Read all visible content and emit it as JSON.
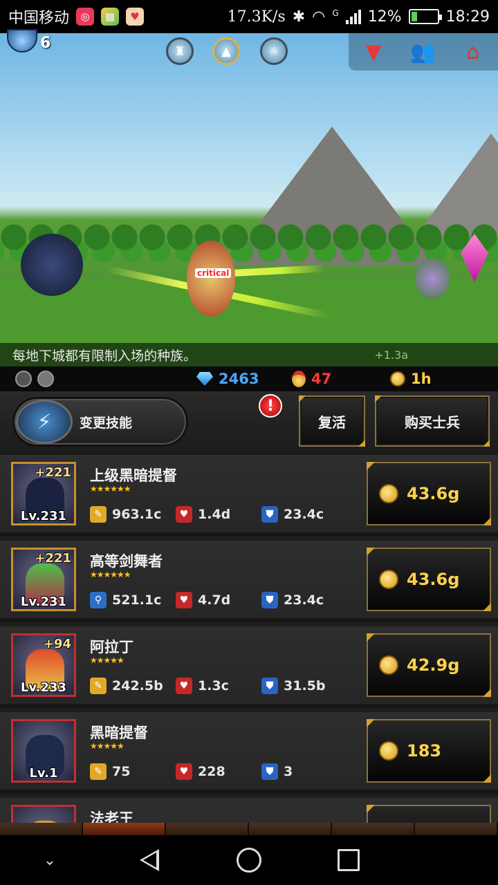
{
  "status_bar": {
    "carrier": "中国移动",
    "speed": "17.3K/s",
    "network": "G",
    "battery": "12%",
    "time": "18:29"
  },
  "game": {
    "player_level": "6",
    "effect_text": "critical",
    "tip": "每地下城都有限制入场的种族。",
    "rate": "+1.3a"
  },
  "resources": {
    "gems": "2463",
    "medals": "47",
    "time_boost": "1h"
  },
  "actions": {
    "change_skill": "变更技能",
    "revive": "复活",
    "buy_soldier": "购买士兵",
    "alert": "!"
  },
  "units": [
    {
      "name": "上级黑暗提督",
      "plus": "+221",
      "level": "Lv.231",
      "stars": "★★★★★★",
      "attack": "963.1c",
      "hp": "1.4d",
      "defense": "23.4c",
      "price": "43.6g"
    },
    {
      "name": "高等剑舞者",
      "plus": "+221",
      "level": "Lv.231",
      "stars": "★★★★★★",
      "attack": "521.1c",
      "hp": "4.7d",
      "defense": "23.4c",
      "price": "43.6g"
    },
    {
      "name": "阿拉丁",
      "plus": "+94",
      "level": "Lv.233",
      "stars": "★★★★★",
      "attack": "242.5b",
      "hp": "1.3c",
      "defense": "31.5b",
      "price": "42.9g"
    },
    {
      "name": "黑暗提督",
      "plus": "",
      "level": "Lv.1",
      "stars": "★★★★★",
      "attack": "75",
      "hp": "228",
      "defense": "3",
      "price": "183"
    },
    {
      "name": "法老王",
      "plus": "",
      "level": "",
      "stars": "",
      "attack": "",
      "hp": "",
      "defense": "",
      "price": ""
    }
  ],
  "colors": {
    "gem_text": "#4aa8ff",
    "medal_text": "#ff3a3a",
    "gold_text": "#ffd24a",
    "frame_gold": "#8a7340"
  }
}
